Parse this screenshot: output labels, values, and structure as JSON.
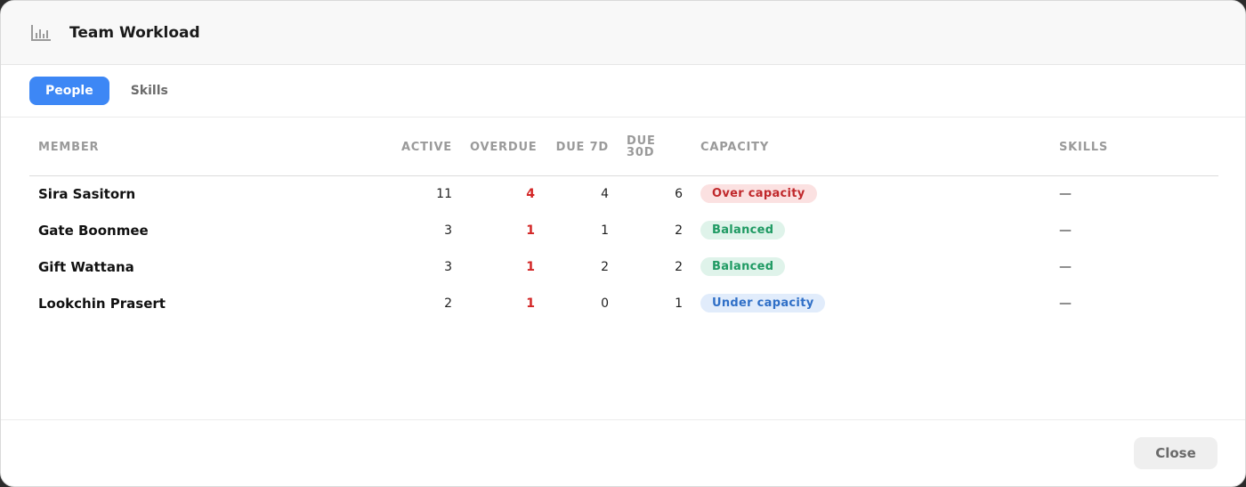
{
  "header": {
    "title": "Team Workload",
    "icon": "bar-chart-icon"
  },
  "tabs": [
    {
      "label": "People",
      "active": true
    },
    {
      "label": "Skills",
      "active": false
    }
  ],
  "table": {
    "columns": [
      "Member",
      "Active",
      "Overdue",
      "Due 7D",
      "Due 30D",
      "Capacity",
      "Skills"
    ],
    "rows": [
      {
        "member": "Sira Sasitorn",
        "active": "11",
        "overdue": "4",
        "due7": "4",
        "due30": "6",
        "capacity": "Over capacity",
        "capacity_status": "over",
        "skills": "—"
      },
      {
        "member": "Gate Boonmee",
        "active": "3",
        "overdue": "1",
        "due7": "1",
        "due30": "2",
        "capacity": "Balanced",
        "capacity_status": "balanced",
        "skills": "—"
      },
      {
        "member": "Gift Wattana",
        "active": "3",
        "overdue": "1",
        "due7": "2",
        "due30": "2",
        "capacity": "Balanced",
        "capacity_status": "balanced",
        "skills": "—"
      },
      {
        "member": "Lookchin Prasert",
        "active": "2",
        "overdue": "1",
        "due7": "0",
        "due30": "1",
        "capacity": "Under capacity",
        "capacity_status": "under",
        "skills": "—"
      }
    ]
  },
  "footer": {
    "close_label": "Close"
  },
  "colors": {
    "accent": "#3d87f5",
    "overdue": "#d32626",
    "over": "#c0282b",
    "balanced": "#1f9a63",
    "under": "#2f6fc7"
  }
}
